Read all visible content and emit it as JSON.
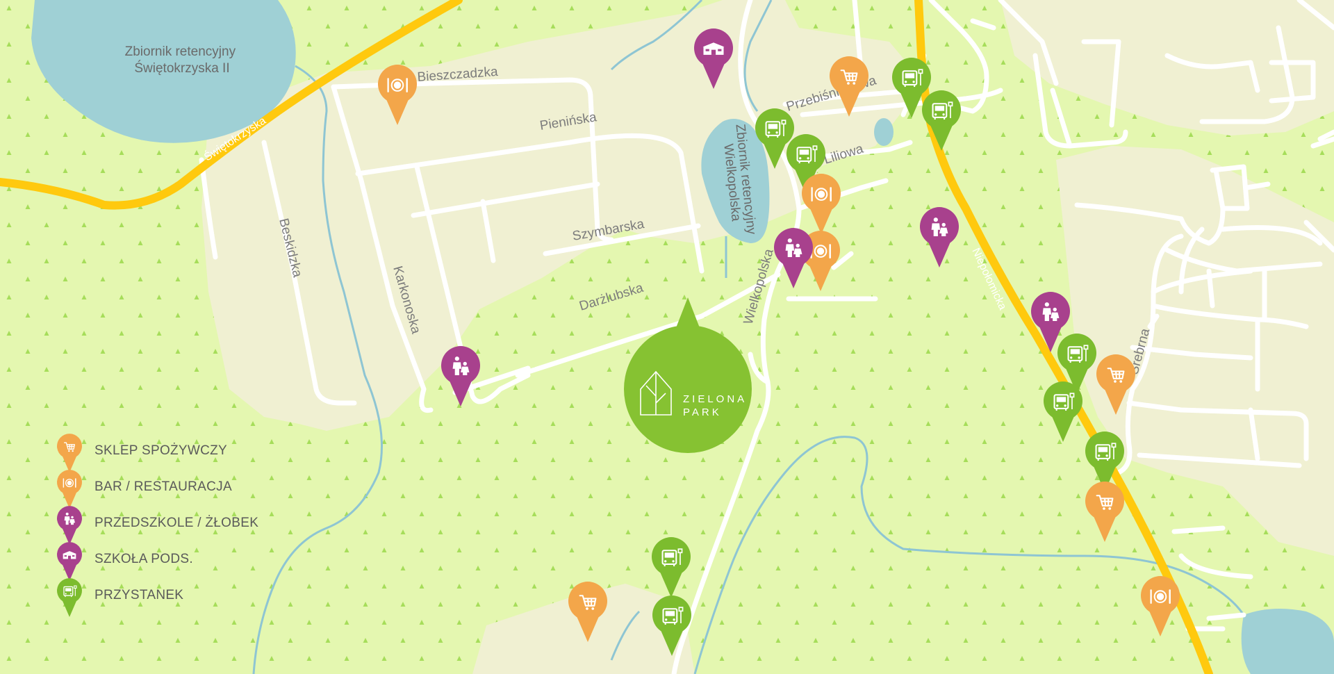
{
  "colors": {
    "background": "#e4f7b0",
    "forest": "#d6f594",
    "urban": "#f0f0d2",
    "road": "#ffffff",
    "main_road": "#ffc90e",
    "water": "#9fd0d5",
    "stream": "#8ec5d3",
    "shop": "#f3a64a",
    "restaurant": "#f3a64a",
    "kindergarten": "#a8418d",
    "school": "#a8418d",
    "bus_stop": "#7cbc2e",
    "brand": "#86c232"
  },
  "lakes": {
    "north_label": [
      "Zbiornik retencyjny",
      "Świętokrzyska II"
    ],
    "center_label": [
      "Zbiornik retencyjny",
      "Wielkopolska"
    ]
  },
  "streets": {
    "swietokrzyska": "Świętokrzyska",
    "bieszczadzka": "Bieszczadzka",
    "pieninska": "Pienińska",
    "szymbarska": "Szymbarska",
    "darzlubska": "Darżlubska",
    "beskidzka": "Beskidzka",
    "karkonoska": "Karkonoska",
    "wielkopolska": "Wielkopolska",
    "przebisniegowa": "Przebiśniegowa",
    "liliowa": "Liliowa",
    "niepolomicka": "Niepołomicka",
    "srebrna": "Srebrna"
  },
  "brand": {
    "line1": "ZIELONA",
    "line2": "PARK"
  },
  "legend": [
    {
      "type": "shop",
      "label": "SKLEP SPOŻYWCZY",
      "icon": "cart-icon"
    },
    {
      "type": "restaurant",
      "label": "BAR / RESTAURACJA",
      "icon": "plate-icon"
    },
    {
      "type": "kindergarten",
      "label": "PRZEDSZKOLE / ŻŁOBEK",
      "icon": "kids-icon"
    },
    {
      "type": "school",
      "label": "SZKOŁA PODS.",
      "icon": "school-icon"
    },
    {
      "type": "bus",
      "label": "PRZYSTANEK",
      "icon": "bus-icon"
    }
  ],
  "pois": [
    {
      "type": "restaurant",
      "name": "restaurant-bieszczadzka"
    },
    {
      "type": "school",
      "name": "school-north"
    },
    {
      "type": "shop",
      "name": "shop-przebisniegowa"
    },
    {
      "type": "bus",
      "name": "bus-stop-przebisniegowa"
    },
    {
      "type": "bus",
      "name": "bus-stop-niepolomicka-north"
    },
    {
      "type": "bus",
      "name": "bus-stop-wielkopolska-1"
    },
    {
      "type": "bus",
      "name": "bus-stop-wielkopolska-2"
    },
    {
      "type": "restaurant",
      "name": "restaurant-liliowa"
    },
    {
      "type": "restaurant",
      "name": "restaurant-wielkopolska"
    },
    {
      "type": "kindergarten",
      "name": "kindergarten-wielkopolska"
    },
    {
      "type": "kindergarten",
      "name": "kindergarten-niepolomicka-north"
    },
    {
      "type": "kindergarten",
      "name": "kindergarten-darzlubska"
    },
    {
      "type": "kindergarten",
      "name": "kindergarten-srebrna"
    },
    {
      "type": "bus",
      "name": "bus-stop-srebrna-1"
    },
    {
      "type": "shop",
      "name": "shop-srebrna"
    },
    {
      "type": "bus",
      "name": "bus-stop-srebrna-2"
    },
    {
      "type": "bus",
      "name": "bus-stop-niepolomicka-south"
    },
    {
      "type": "shop",
      "name": "shop-niepolomicka"
    },
    {
      "type": "restaurant",
      "name": "restaurant-niepolomicka"
    },
    {
      "type": "bus",
      "name": "bus-stop-south-1"
    },
    {
      "type": "bus",
      "name": "bus-stop-south-2"
    },
    {
      "type": "shop",
      "name": "shop-south"
    }
  ]
}
